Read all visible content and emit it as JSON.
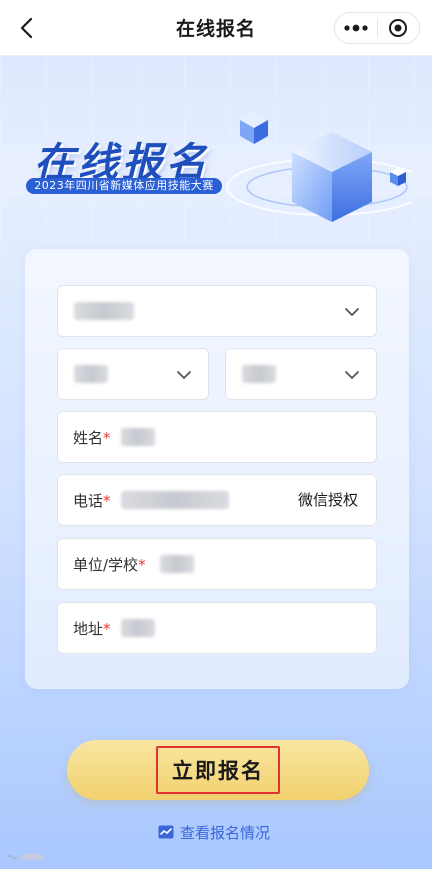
{
  "navbar": {
    "title": "在线报名",
    "icons": {
      "back": "chevron-left-icon",
      "more": "more-dots-icon",
      "close": "target-circle-icon"
    }
  },
  "hero": {
    "title": "在线报名",
    "subtitle": "2023年四川省新媒体应用技能大赛"
  },
  "form": {
    "fields": {
      "name_label": "姓名",
      "phone_label": "电话",
      "phone_auth": "微信授权",
      "org_label": "单位/学校",
      "address_label": "地址",
      "required_mark": "*"
    }
  },
  "actions": {
    "submit_label": "立即报名",
    "check_status_label": "查看报名情况"
  },
  "colors": {
    "primary_blue": "#1f4ebd",
    "submit_gradient_top": "#f8e6a2",
    "submit_gradient_bottom": "#f2d16e",
    "required_red": "#e03b3b",
    "link_blue": "#3a66d9"
  }
}
